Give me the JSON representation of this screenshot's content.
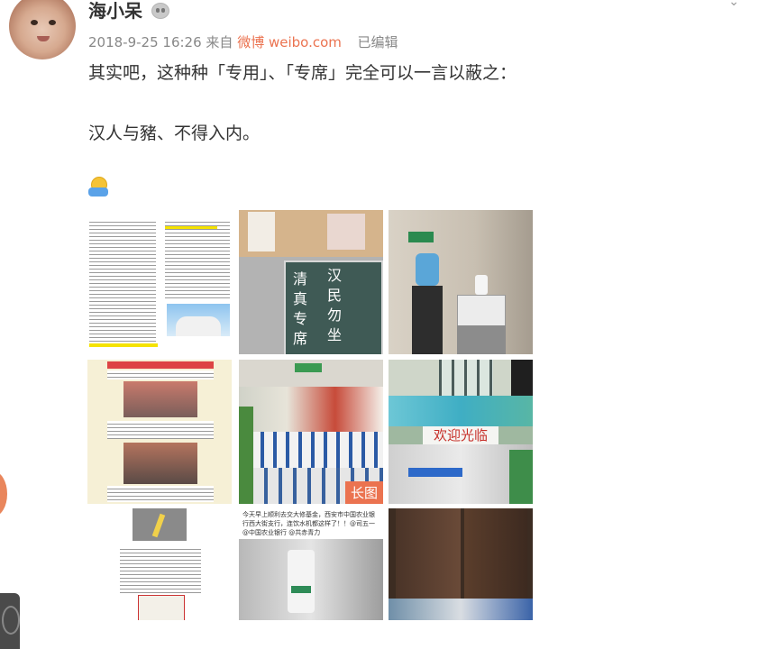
{
  "post": {
    "username": "海小呆",
    "date": "2018-9-25 16:26",
    "source_prefix": "来自",
    "source": "微博 weibo.com",
    "edited": "已编辑",
    "line1": "其实吧，这种种「专用」、「专席」完全可以一言以蔽之：",
    "line2": "汉人与豬、不得入内。",
    "emoji": "hug-emoji"
  },
  "images": [
    {
      "name": "document-screenshot",
      "sign_text": ""
    },
    {
      "name": "sign-photo",
      "sign_text": "清真专席 汉民勿坐"
    },
    {
      "name": "water-dispenser-photo",
      "sign_text": ""
    },
    {
      "name": "news-article-screenshot",
      "sign_text": ""
    },
    {
      "name": "store-shelves-photo",
      "badge": "长图"
    },
    {
      "name": "shop-front-photo",
      "sign_text": "欢迎光临"
    },
    {
      "name": "notice-screenshot",
      "sign_text": ""
    },
    {
      "name": "bank-water-dispenser-photo",
      "caption": "今天早上顺利去交大修基金，西安市中国农业银行西大街支行，连饮水机都这样了！！@司五一 @中国农业银行 @共赤青力"
    },
    {
      "name": "door-photo",
      "sign_text": ""
    }
  ],
  "colors": {
    "accent": "#eb7350",
    "text": "#333333",
    "meta": "#888888"
  }
}
